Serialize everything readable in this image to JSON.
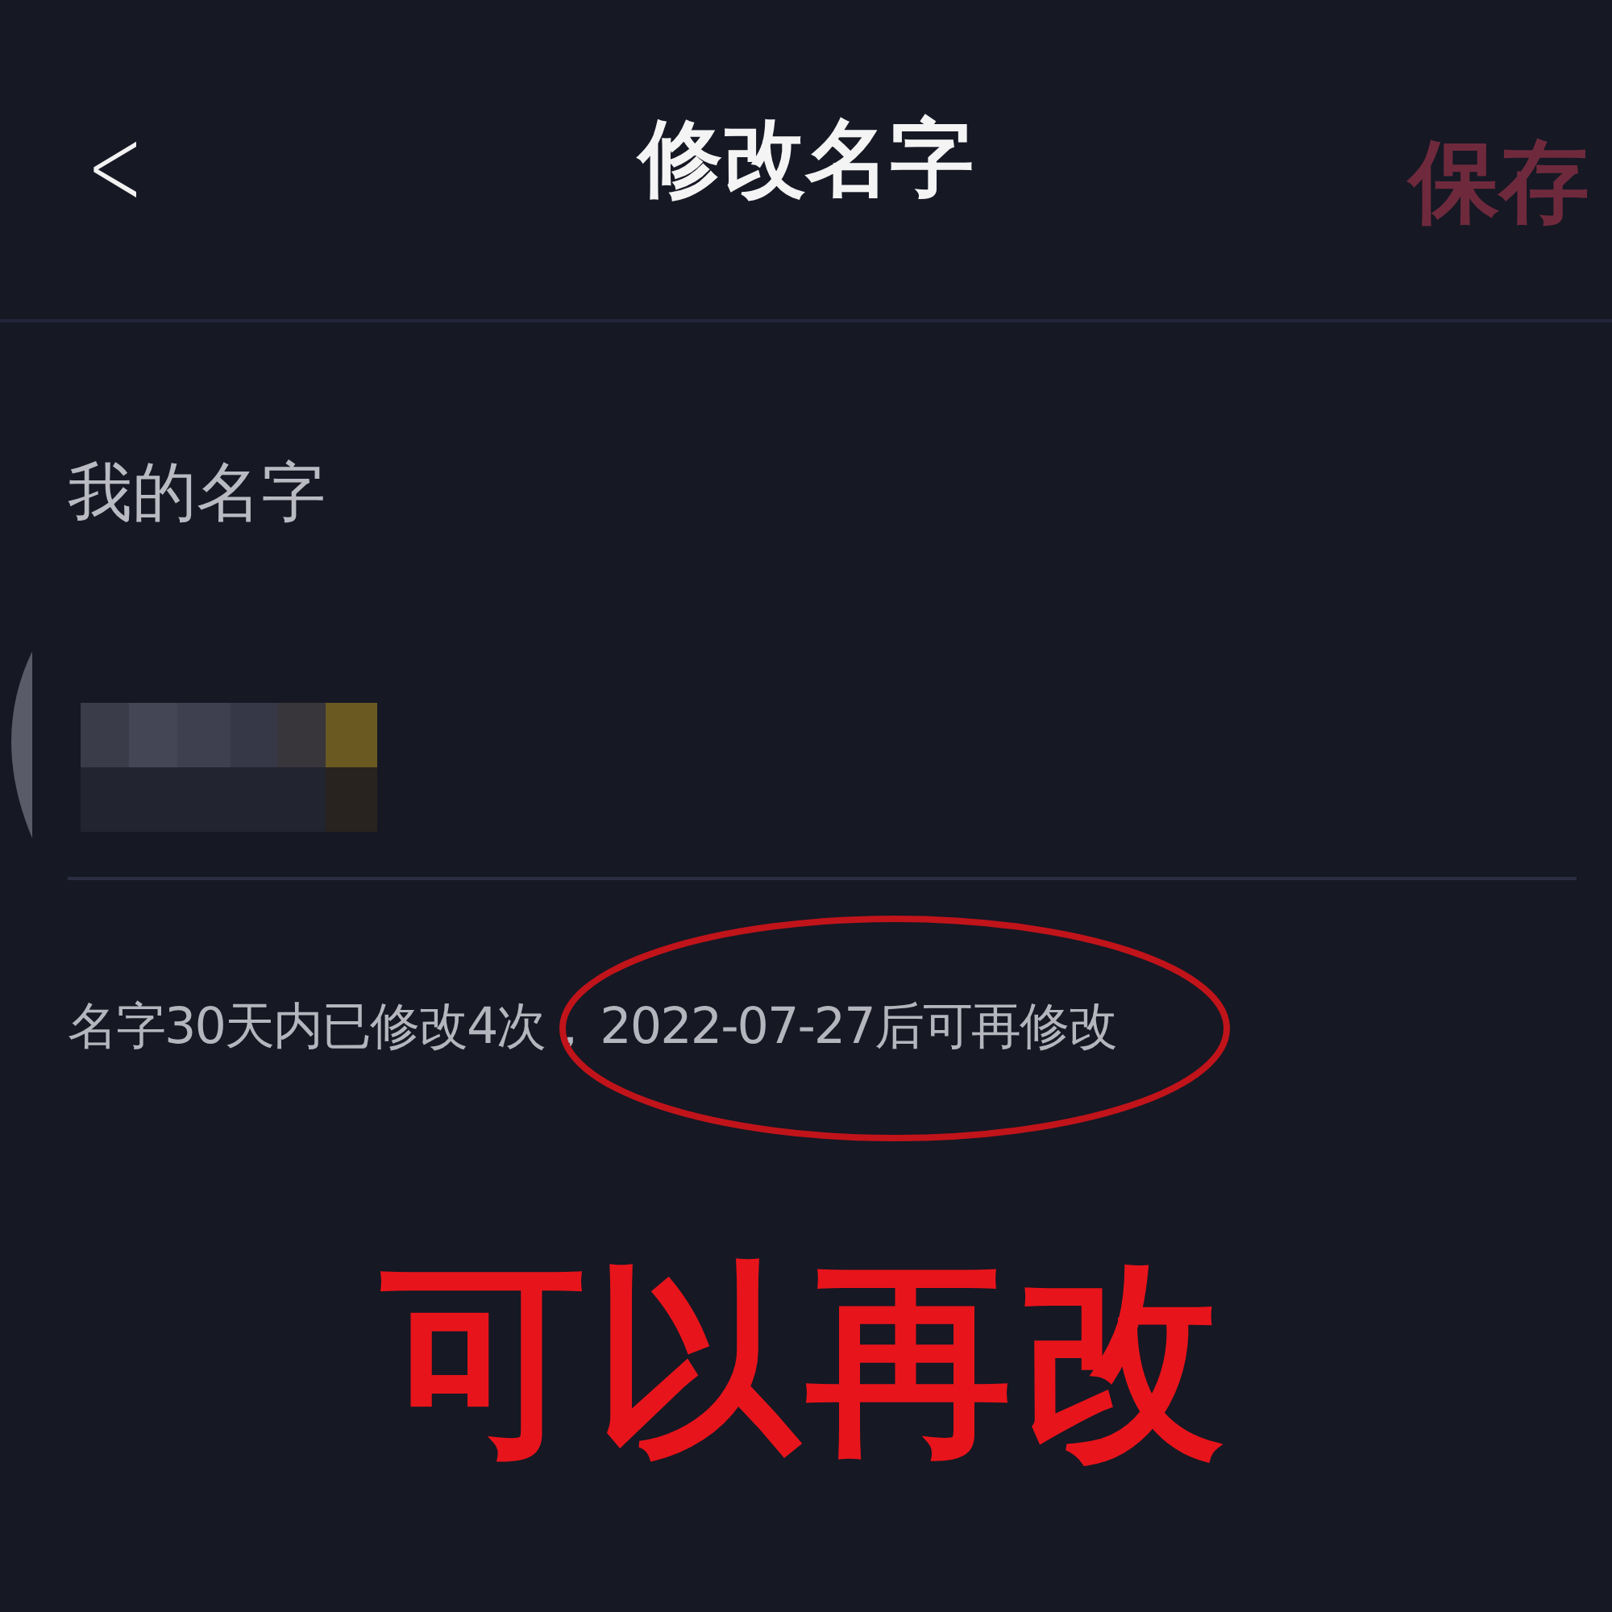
{
  "header": {
    "back": "<",
    "title": "修改名字",
    "save": {
      "label": "保存",
      "disabled": true
    }
  },
  "field": {
    "label": "我的名字"
  },
  "hint": {
    "before": "名字30天内已修改4次，",
    "highlighted": "2022-07-27后可再修改"
  },
  "annotation": {
    "text": "可以再改",
    "color": "#e8141b"
  }
}
